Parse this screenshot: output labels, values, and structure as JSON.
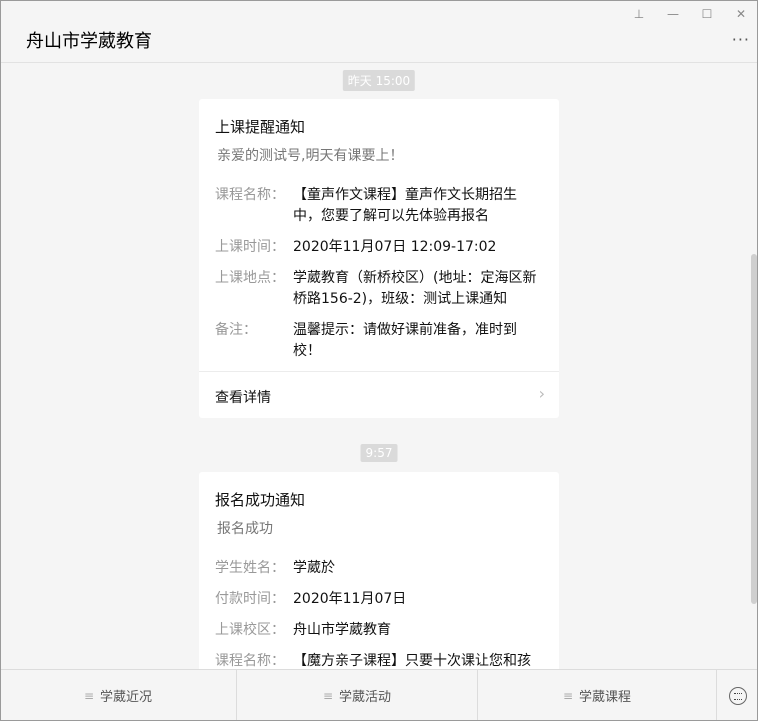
{
  "window_controls": {
    "pin": "⊥",
    "minimize": "—",
    "maximize": "☐",
    "close": "✕"
  },
  "header": {
    "title": "舟山市学葳教育",
    "more": "···"
  },
  "messages": [
    {
      "timestamp": "昨天 15:00",
      "title": "上课提醒通知",
      "subtitle": "亲爱的测试号,明天有课要上！",
      "fields": [
        {
          "label": "课程名称：",
          "value": "【童声作文课程】童声作文长期招生中，您要了解可以先体验再报名"
        },
        {
          "label": "上课时间：",
          "value": "2020年11月07日 12:09-17:02"
        },
        {
          "label": "上课地点：",
          "value": "学葳教育（新桥校区）(地址：定海区新桥路156-2)，班级：测试上课通知"
        },
        {
          "label": "备注：",
          "value": "温馨提示：请做好课前准备，准时到校！"
        }
      ],
      "detail_label": "查看详情"
    },
    {
      "timestamp": "9:57",
      "title": "报名成功通知",
      "subtitle": "报名成功",
      "fields": [
        {
          "label": "学生姓名：",
          "value": "学葳於"
        },
        {
          "label": "付款时间：",
          "value": "2020年11月07日"
        },
        {
          "label": "上课校区：",
          "value": "舟山市学葳教育"
        },
        {
          "label": "课程名称：",
          "value": "【魔方亲子课程】只要十次课让您和孩"
        }
      ]
    }
  ],
  "menu": {
    "items": [
      {
        "icon": "≡",
        "label": "学葳近况"
      },
      {
        "icon": "≡",
        "label": "学葳活动"
      },
      {
        "icon": "≡",
        "label": "学葳课程"
      }
    ]
  }
}
